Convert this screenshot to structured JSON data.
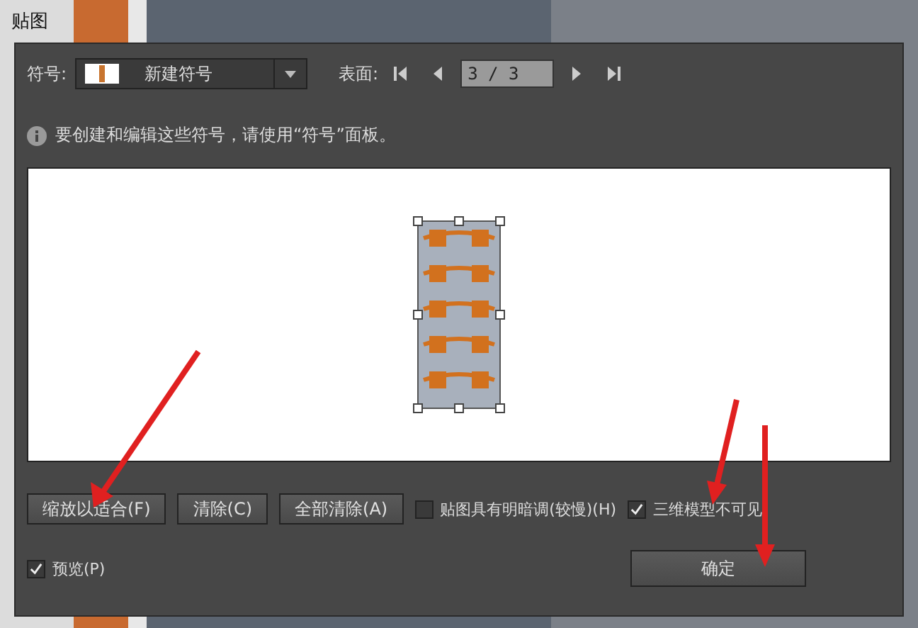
{
  "window": {
    "title": "贴图"
  },
  "symbol": {
    "label": "符号:",
    "value": "新建符号"
  },
  "surface": {
    "label": "表面:",
    "value": "3 / 3"
  },
  "info": "要创建和编辑这些符号，请使用“符号”面板。",
  "buttons": [
    "缩放以适合(F)",
    "清除(C)",
    "全部清除(A)"
  ],
  "options": [
    {
      "label": "贴图具有明暗调(较慢)(H)",
      "checked": false
    },
    {
      "label": "三维模型不可见",
      "checked": true
    }
  ],
  "preview": {
    "label": "预览(P)",
    "checked": true
  },
  "ok": "确定"
}
